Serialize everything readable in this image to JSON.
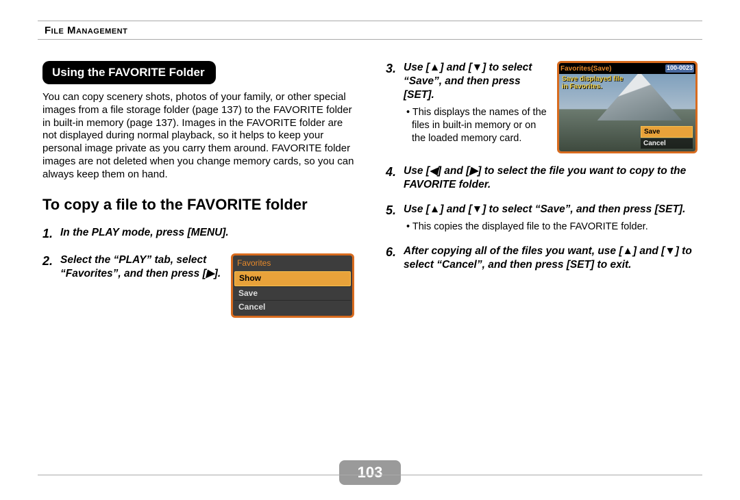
{
  "header": {
    "section": "File Management"
  },
  "page_number": "103",
  "left": {
    "section_title": "Using the FAVORITE Folder",
    "intro": "You can copy scenery shots, photos of your family, or other special images from a file storage folder (page 137) to the FAVORITE folder in built-in memory (page 137). Images in the FAVORITE folder are not displayed during normal playback, so it helps to keep your personal image private as you carry them around. FAVORITE folder images are not deleted when you change memory cards, so you can always keep them on hand.",
    "subhead": "To copy a file to the FAVORITE folder",
    "step1": "In the PLAY mode, press [MENU].",
    "step2": "Select the “PLAY” tab, select “Favorites”, and then press [▶].",
    "menu": {
      "title": "Favorites",
      "items": [
        "Show",
        "Save",
        "Cancel"
      ],
      "selected": "Show"
    }
  },
  "right": {
    "step3": "Use [▲] and [▼] to select “Save”, and then press [SET].",
    "step3_note": "This displays the names of the files in built-in memory or on the loaded memory card.",
    "step4": "Use [◀] and [▶] to select the file you want to copy to the FAVORITE folder.",
    "step5": "Use [▲] and [▼] to select “Save”, and then press [SET].",
    "step5_note": "This copies the displayed file to the FAVORITE folder.",
    "step6": "After copying all of the files you want, use [▲] and [▼] to select “Cancel”, and then press [SET] to exit.",
    "save_screen": {
      "title": "Favorites(Save)",
      "id": "100-0023",
      "caption1": "Save displayed file",
      "caption2": "in Favorites.",
      "options": [
        "Save",
        "Cancel"
      ],
      "selected": "Save"
    }
  }
}
